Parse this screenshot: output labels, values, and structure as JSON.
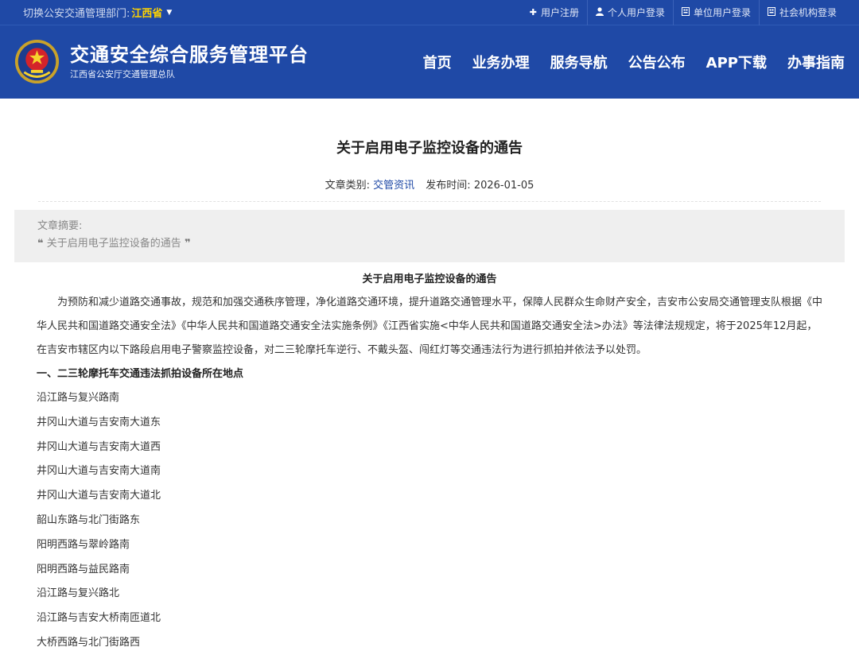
{
  "topbar": {
    "switch_label": "切换公安交通管理部门:",
    "province": "江西省",
    "links": [
      {
        "icon": "plus-icon",
        "glyph": "✚",
        "label": "用户注册"
      },
      {
        "icon": "user-icon",
        "glyph": "👤",
        "label": "个人用户登录"
      },
      {
        "icon": "building-icon",
        "glyph": "▣",
        "label": "单位用户登录"
      },
      {
        "icon": "institution-icon",
        "glyph": "▣",
        "label": "社会机构登录"
      }
    ]
  },
  "brand": {
    "title": "交通安全综合服务管理平台",
    "subtitle": "江西省公安厅交通管理总队"
  },
  "nav": [
    "首页",
    "业务办理",
    "服务导航",
    "公告公布",
    "APP下载",
    "办事指南"
  ],
  "article": {
    "title": "关于启用电子监控设备的通告",
    "category_label": "文章类别:",
    "category": "交管资讯",
    "date_label": "发布时间:",
    "date": "2026-01-05",
    "summary_label": "文章摘要:",
    "summary_text": "关于启用电子监控设备的通告",
    "content_title": "关于启用电子监控设备的通告",
    "paragraph": "为预防和减少道路交通事故，规范和加强交通秩序管理，净化道路交通环境，提升道路交通管理水平，保障人民群众生命财产安全，吉安市公安局交通管理支队根据《中华人民共和国道路交通安全法》《中华人民共和国道路交通安全法实施条例》《江西省实施<中华人民共和国道路交通安全法>办法》等法律法规规定，将于2025年12月起，在吉安市辖区内以下路段启用电子警察监控设备，对二三轮摩托车逆行、不戴头盔、闯红灯等交通违法行为进行抓拍并依法予以处罚。",
    "section_heading": "一、二三轮摩托车交通违法抓拍设备所在地点",
    "locations": [
      "沿江路与复兴路南",
      "井冈山大道与吉安南大道东",
      "井冈山大道与吉安南大道西",
      "井冈山大道与吉安南大道南",
      "井冈山大道与吉安南大道北",
      "韶山东路与北门街路东",
      "阳明西路与翠岭路南",
      "阳明西路与益民路南",
      "沿江路与复兴路北",
      "沿江路与吉安大桥南匝道北",
      "大桥西路与北门街路西"
    ]
  },
  "colors": {
    "header_bg": "#1f49a6",
    "province_highlight": "#ffd400",
    "category_link": "#1f49a6",
    "summary_bg": "#efefef"
  }
}
